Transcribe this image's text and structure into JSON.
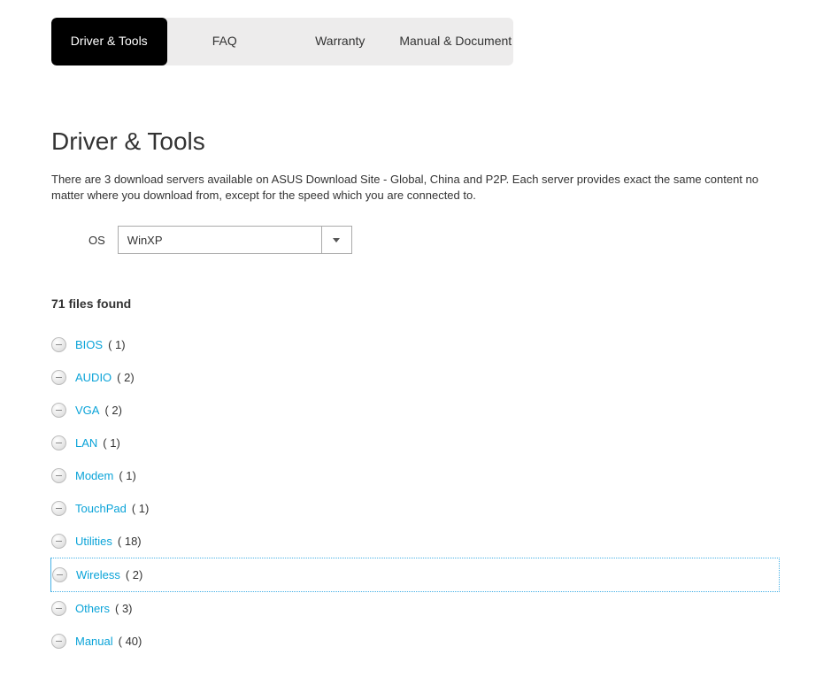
{
  "tabs": [
    {
      "label": "Driver & Tools",
      "active": true
    },
    {
      "label": "FAQ",
      "active": false
    },
    {
      "label": "Warranty",
      "active": false
    },
    {
      "label": "Manual & Document",
      "active": false
    }
  ],
  "page_title": "Driver & Tools",
  "description": "There are 3 download servers available on ASUS Download Site - Global, China and P2P. Each server provides exact the same content no matter where you download from, except for the speed which you are connected to.",
  "os_label": "OS",
  "os_selected": "WinXP",
  "files_found_label": "71 files found",
  "categories": [
    {
      "name": "BIOS",
      "count": "( 1)",
      "selected": false
    },
    {
      "name": "AUDIO",
      "count": "( 2)",
      "selected": false
    },
    {
      "name": "VGA",
      "count": "( 2)",
      "selected": false
    },
    {
      "name": "LAN",
      "count": "( 1)",
      "selected": false
    },
    {
      "name": "Modem",
      "count": "( 1)",
      "selected": false
    },
    {
      "name": "TouchPad",
      "count": "( 1)",
      "selected": false
    },
    {
      "name": "Utilities",
      "count": "( 18)",
      "selected": false
    },
    {
      "name": "Wireless",
      "count": "( 2)",
      "selected": true
    },
    {
      "name": "Others",
      "count": "( 3)",
      "selected": false
    },
    {
      "name": "Manual",
      "count": "( 40)",
      "selected": false
    }
  ]
}
